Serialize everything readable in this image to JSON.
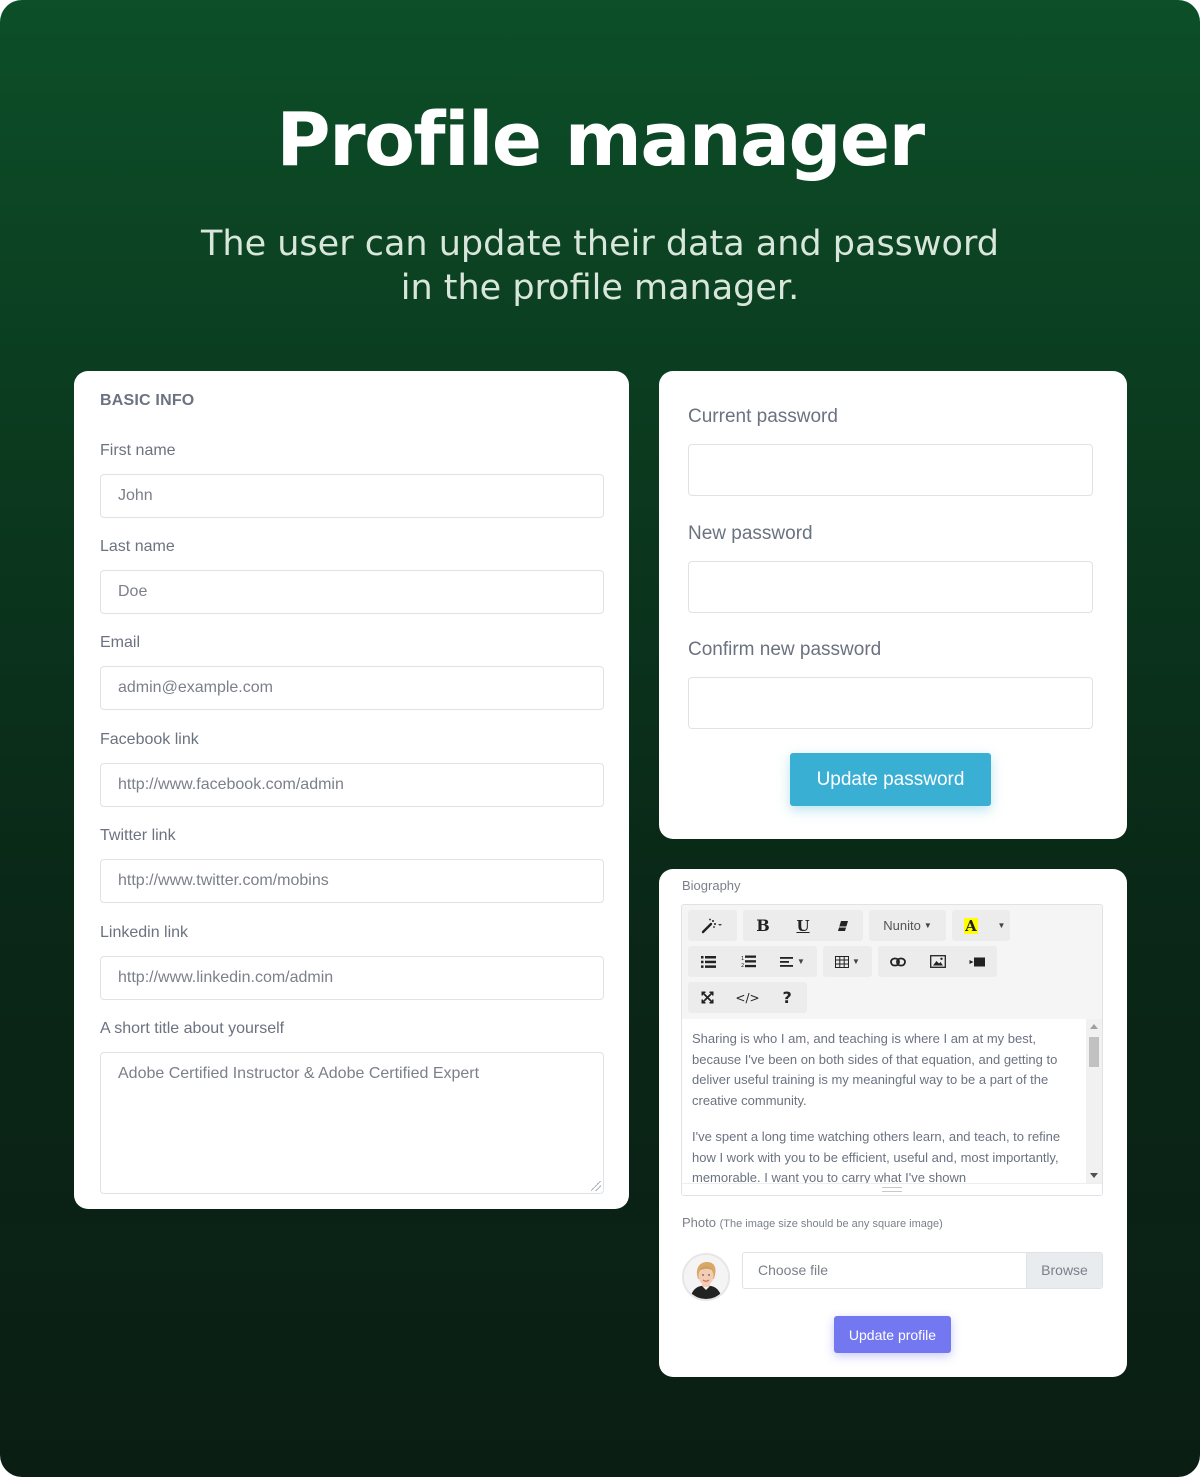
{
  "hero": {
    "title": "Profile manager",
    "subtitle_line1": "The user can update their data and password",
    "subtitle_line2": "in the profile manager."
  },
  "basic_info": {
    "title": "BASIC INFO",
    "fields": [
      {
        "label": "First name",
        "value": "John"
      },
      {
        "label": "Last name",
        "value": "Doe"
      },
      {
        "label": "Email",
        "value": "admin@example.com"
      },
      {
        "label": "Facebook link",
        "value": "http://www.facebook.com/admin"
      },
      {
        "label": "Twitter link",
        "value": "http://www.twitter.com/mobins"
      },
      {
        "label": "Linkedin link",
        "value": "http://www.linkedin.com/admin"
      }
    ],
    "short_title": {
      "label": "A short title about yourself",
      "value": "Adobe Certified Instructor & Adobe Certified Expert"
    }
  },
  "password": {
    "fields": [
      {
        "label": "Current password",
        "value": ""
      },
      {
        "label": "New password",
        "value": ""
      },
      {
        "label": "Confirm new password",
        "value": ""
      }
    ],
    "submit_label": "Update password",
    "accent": "#3aafd4"
  },
  "biography": {
    "label": "Biography",
    "toolbar": {
      "font_name": "Nunito",
      "highlight_color": "#ffff00",
      "buttons": [
        "magic-wand",
        "bold",
        "underline",
        "eraser",
        "font-family",
        "color",
        "unordered-list",
        "ordered-list",
        "align",
        "table",
        "link",
        "picture",
        "video",
        "fullscreen",
        "code-view",
        "help"
      ]
    },
    "paragraphs": [
      "Sharing is who I am, and teaching is where I am at my best, because I've been on both sides of that equation, and getting to deliver useful training is my meaningful way to be a part of the creative community.",
      "I've spent a long time watching others learn, and teach, to refine how I work with you to be efficient, useful and, most importantly, memorable. I want you to carry what I've shown"
    ]
  },
  "photo": {
    "label": "Photo",
    "note": "(The image size should be any square image)",
    "file_placeholder": "Choose file",
    "browse_label": "Browse",
    "submit_label": "Update profile",
    "accent": "#7377f0"
  }
}
